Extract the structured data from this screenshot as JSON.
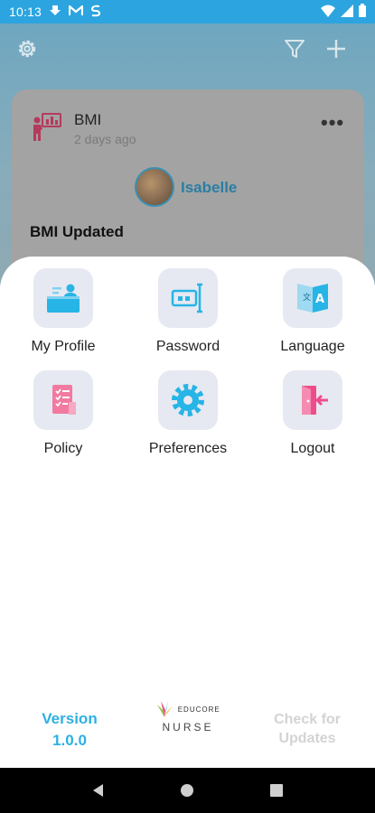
{
  "status_bar": {
    "time": "10:13",
    "icons": [
      "download-icon",
      "gmail-icon",
      "sync-icon",
      "wifi-icon",
      "signal-icon",
      "battery-icon"
    ]
  },
  "header": {
    "background": "#8aaebd",
    "actions": [
      "gear-icon",
      "filter-icon",
      "plus-icon"
    ]
  },
  "card": {
    "title": "BMI",
    "time": "2 days ago",
    "student": "Isabelle",
    "heading": "BMI Updated",
    "menu_glyph": "•••"
  },
  "menu": {
    "items": [
      {
        "label": "My Profile",
        "icon": "profile-icon"
      },
      {
        "label": "Password",
        "icon": "password-icon"
      },
      {
        "label": "Language",
        "icon": "language-icon"
      },
      {
        "label": "Policy",
        "icon": "policy-icon"
      },
      {
        "label": "Preferences",
        "icon": "preferences-icon"
      },
      {
        "label": "Logout",
        "icon": "logout-icon"
      }
    ]
  },
  "footer": {
    "version_label": "Version",
    "version_number": "1.0.0",
    "logo_small": "EDUCORE",
    "logo_main": "NURSE",
    "check_updates": "Check for Updates"
  },
  "colors": {
    "accent": "#2cb1e3",
    "status_bar": "#2ba4df",
    "tile_bg": "#e6e9f1",
    "logout_pink": "#ee4d8b",
    "policy_pink": "#f06292"
  }
}
